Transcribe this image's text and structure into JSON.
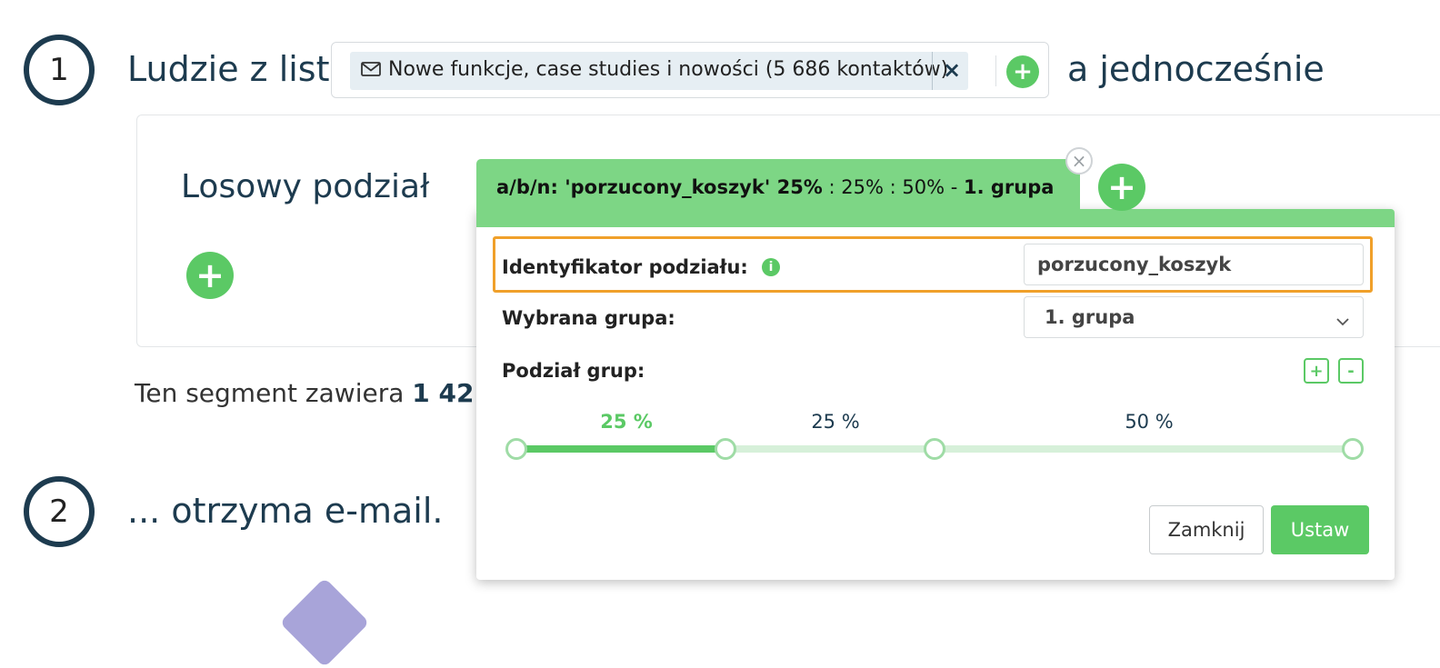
{
  "step1": {
    "number": "1",
    "prefix": "Ludzie z list",
    "list_tag": {
      "label": "Nowe funkcje, case studies i nowości (5 686 kontaktów)",
      "remove_label": "×",
      "icon": "mail-icon"
    },
    "add_label": "+",
    "suffix": "a jednocześnie"
  },
  "split_card": {
    "title": "Losowy podział",
    "add_label": "+",
    "segment_prefix": "Ten segment zawiera",
    "segment_count": "1 42"
  },
  "step2": {
    "number": "2",
    "text": "... otrzyma e-mail."
  },
  "popup": {
    "tab": {
      "prefix": "a/b/n: ",
      "name": "'porzucony_koszyk' 25%",
      "rest": " : 25% : 50% - ",
      "group": "1. grupa"
    },
    "close_label": "×",
    "add_label": "+",
    "id_label": "Identyfikator podziału:",
    "id_value": "porzucony_koszyk",
    "group_label": "Wybrana grupa:",
    "group_value": "1. grupa",
    "split_label": "Podział grup:",
    "add_group_label": "+",
    "remove_group_label": "-",
    "slider": {
      "labels": [
        "25 %",
        "25 %",
        "50 %"
      ],
      "values": [
        25,
        25,
        50
      ],
      "active_index": 0
    },
    "close_button": "Zamknij",
    "set_button": "Ustaw"
  },
  "colors": {
    "green": "#5bc965",
    "accent_orange": "#f0a02a",
    "navy": "#1d3b4f"
  }
}
